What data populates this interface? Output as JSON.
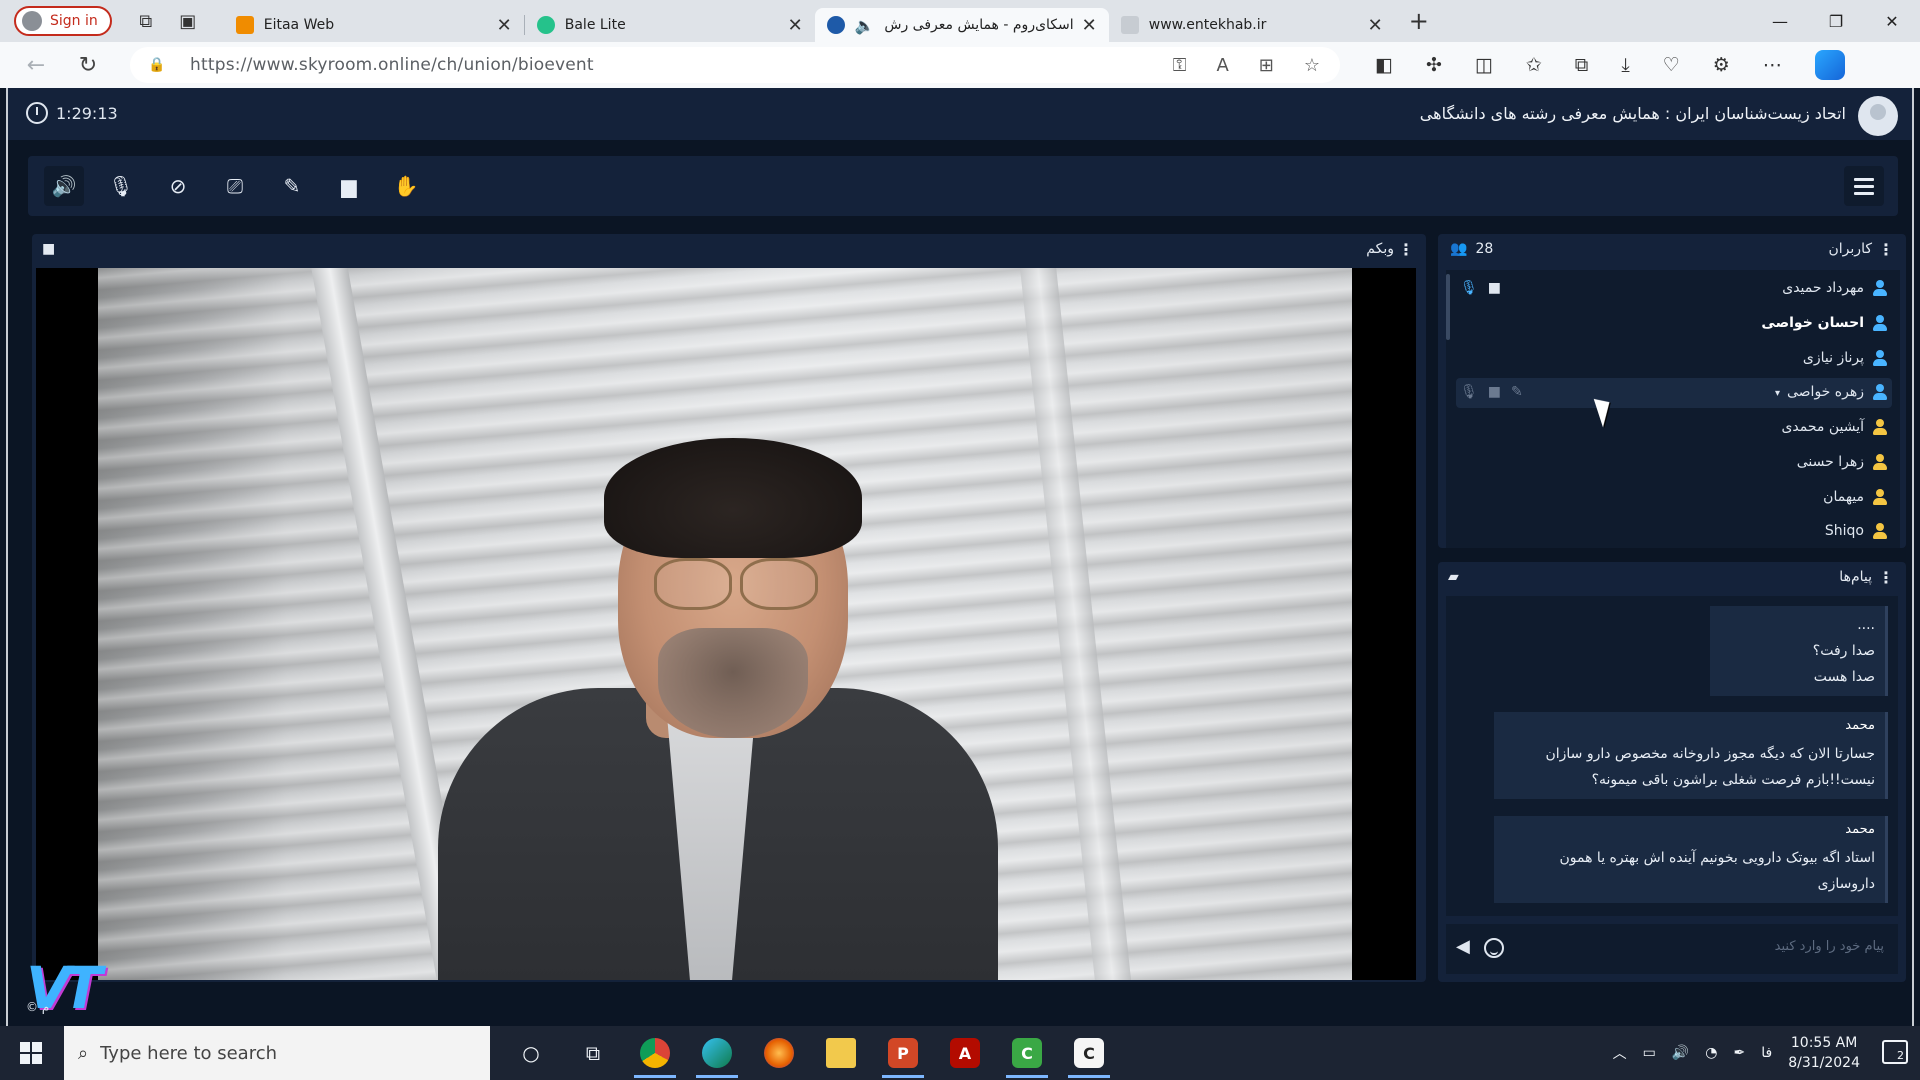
{
  "browser": {
    "signin_label": "Sign in",
    "tabs": [
      {
        "title": "Eitaa Web",
        "favicon_color": "#f08c00"
      },
      {
        "title": "Bale Lite",
        "favicon_color": "#25c28b"
      },
      {
        "title": "اسکای‌روم - همایش معرفی رش",
        "favicon_color": "#1e5aa8",
        "active": true
      },
      {
        "title": "www.entekhab.ir",
        "favicon_color": "#8a8f96"
      }
    ],
    "url": "https://www.skyroom.online/ch/union/bioevent"
  },
  "app": {
    "timer": "1:29:13",
    "room_title": "اتحاد زیست‌شناسان ایران : همایش معرفی رشته های دانشگاهی",
    "webcam_label": "وبکم",
    "users_label": "کاربران",
    "users_count": "28",
    "users": [
      {
        "name": "مهرداد حمیدی",
        "icon": "blue",
        "bold": false
      },
      {
        "name": "احسان خواصی",
        "icon": "blue",
        "bold": true
      },
      {
        "name": "پرناز نیازی",
        "icon": "blue",
        "bold": false
      },
      {
        "name": "زهره خواصی",
        "icon": "blue",
        "bold": false
      },
      {
        "name": "آیشین محمدی",
        "icon": "gold",
        "bold": false
      },
      {
        "name": "زهرا حسنی",
        "icon": "gold",
        "bold": false
      },
      {
        "name": "میهمان",
        "icon": "gold",
        "bold": false
      },
      {
        "name": "Shiqo",
        "icon": "gold",
        "bold": false
      }
    ],
    "messages_label": "پیام‌ها",
    "messages": [
      {
        "sender": "",
        "lines": [
          "....",
          "صدا رفت؟",
          "صدا هست"
        ]
      },
      {
        "sender": "محمد",
        "lines": [
          "جسارتا الان که دیگه مجوز داروخانه مخصوص دارو سازان",
          "نیست!!بازم فرصت شغلی براشون باقی میمونه؟"
        ]
      },
      {
        "sender": "محمد",
        "lines": [
          "استاد اگه بیوتک دارویی بخونیم آینده اش بهتره یا همون",
          "داروسازی"
        ]
      }
    ],
    "message_placeholder": "پیام خود را وارد کنید",
    "watermark": "VT",
    "watermark_copy": "© م"
  },
  "taskbar": {
    "search_placeholder": "Type here to search",
    "time": "10:55 AM",
    "date": "8/31/2024",
    "language": "فا",
    "notification_count": "2"
  }
}
